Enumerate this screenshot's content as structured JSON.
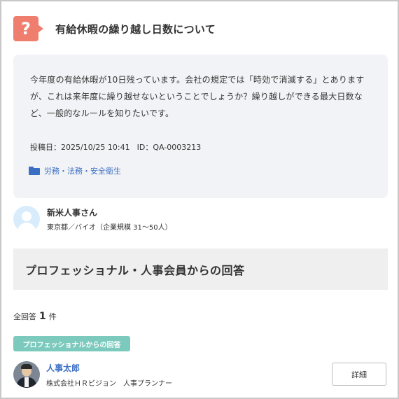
{
  "question": {
    "badge": "?",
    "title": "有給休暇の繰り越し日数について",
    "body": "今年度の有給休暇が10日残っています。会社の規定では「時効で消滅する」とありますが、これは来年度に繰り越せないということでしょうか？繰り越しができる最大日数など、一般的なルールを知りたいです。",
    "posted_label": "投稿日：2025/10/25 10:41",
    "id_label": "ID：QA-0003213",
    "category": "労務・法務・安全衛生"
  },
  "asker": {
    "name": "新米人事さん",
    "detail": "東京都／バイオ（企業規模 31〜50人）"
  },
  "answers_section": {
    "heading": "プロフェッショナル・人事会員からの回答",
    "count_prefix": "全回答",
    "count": "1",
    "count_suffix": "件",
    "pro_tag": "プロフェッショナルからの回答"
  },
  "answerer": {
    "name": "人事太郎",
    "detail": "株式会社ＨＲビジョン　人事プランナー",
    "detail_button": "詳細"
  },
  "colors": {
    "badge": "#f07e6e",
    "link": "#3b6fc4",
    "pro_tag": "#7cc9bd",
    "card_bg": "#f2f3f6"
  },
  "icons": [
    "question-mark-icon",
    "folder-icon",
    "user-avatar-icon"
  ]
}
